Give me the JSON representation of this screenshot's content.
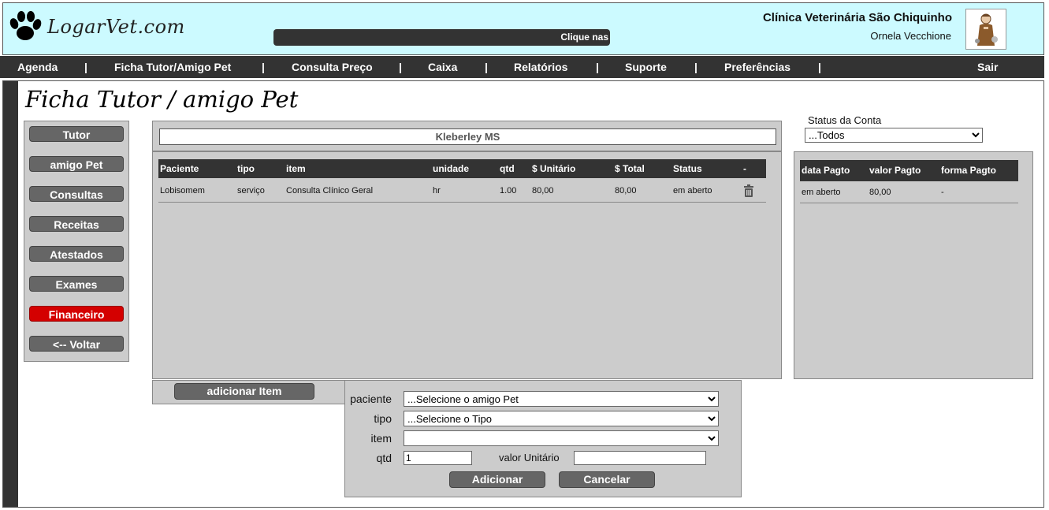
{
  "header": {
    "logo_text": "LogarVet.com",
    "marquee_text": "Clique nas",
    "clinic_name": "Clínica Veterinária São Chiquinho",
    "user_name": "Ornela Vecchione"
  },
  "nav": {
    "items": [
      "Agenda",
      "Ficha Tutor/Amigo Pet",
      "Consulta Preço",
      "Caixa",
      "Relatórios",
      "Suporte",
      "Preferências",
      "Sair"
    ],
    "separator": "|"
  },
  "page": {
    "title": "Ficha Tutor / amigo Pet"
  },
  "side_menu": {
    "items": [
      "Tutor",
      "amigo Pet",
      "Consultas",
      "Receitas",
      "Atestados",
      "Exames",
      "Financeiro",
      "<-- Voltar"
    ],
    "active": "Financeiro",
    "active_color": "#d40000"
  },
  "main": {
    "tutor_name": "Kleberley MS",
    "columns": [
      "Paciente",
      "tipo",
      "item",
      "unidade",
      "qtd",
      "$ Unitário",
      "$ Total",
      "Status",
      "-"
    ],
    "rows": [
      {
        "paciente": "Lobisomem",
        "tipo": "serviço",
        "item": "Consulta Clínico Geral",
        "unidade": "hr",
        "qtd": "1.00",
        "unitario": "80,00",
        "total": "80,00",
        "status": "em aberto",
        "action_icon": "trash-icon"
      }
    ]
  },
  "account": {
    "status_label": "Status da Conta",
    "status_value": "...Todos",
    "columns": [
      "data Pagto",
      "valor Pagto",
      "forma Pagto"
    ],
    "rows": [
      {
        "data": "em aberto",
        "valor": "80,00",
        "forma": "-"
      }
    ]
  },
  "add_item": {
    "button_label": "adicionar Item",
    "paciente_label": "paciente",
    "paciente_value": "...Selecione o amigo Pet",
    "tipo_label": "tipo",
    "tipo_value": "...Selecione o Tipo",
    "item_label": "item",
    "item_value": "",
    "qtd_label": "qtd",
    "qtd_value": "1",
    "valor_label": "valor Unitário",
    "valor_value": "",
    "add_button": "Adicionar",
    "cancel_button": "Cancelar"
  },
  "colors": {
    "header_bg": "#ccfaff",
    "nav_bg": "#333333",
    "panel_bg": "#cccccc",
    "button_bg": "#666666"
  }
}
